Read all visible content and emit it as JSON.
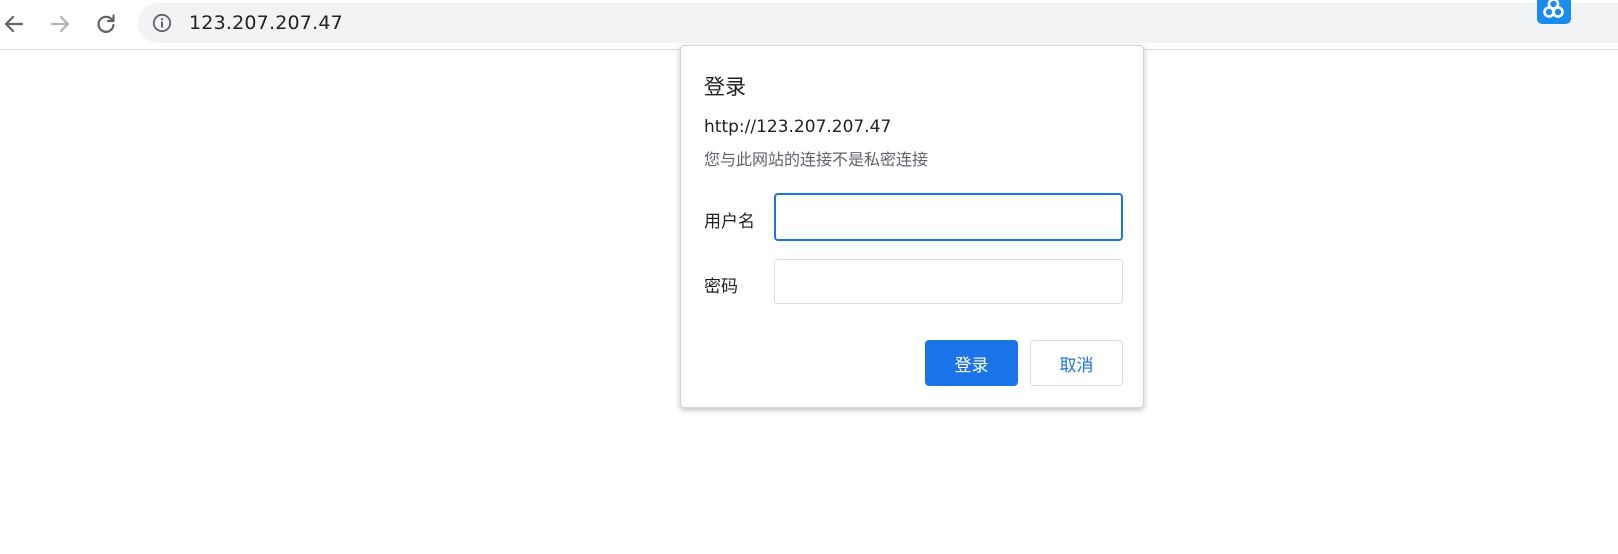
{
  "toolbar": {
    "back_icon": "back-arrow-icon",
    "forward_icon": "forward-arrow-icon",
    "reload_icon": "reload-icon",
    "info_icon": "info-icon",
    "url": "123.207.207.47",
    "extension_icon": "extension-icon"
  },
  "dialog": {
    "title": "登录",
    "site_url": "http://123.207.207.47",
    "warning": "您与此网站的连接不是私密连接",
    "username_label": "用户名",
    "username_value": "",
    "password_label": "密码",
    "password_value": "",
    "login_button": "登录",
    "cancel_button": "取消"
  },
  "colors": {
    "accent": "#1a73e8",
    "extension": "#1a8cf0",
    "omnibox_bg": "#f1f3f4"
  }
}
